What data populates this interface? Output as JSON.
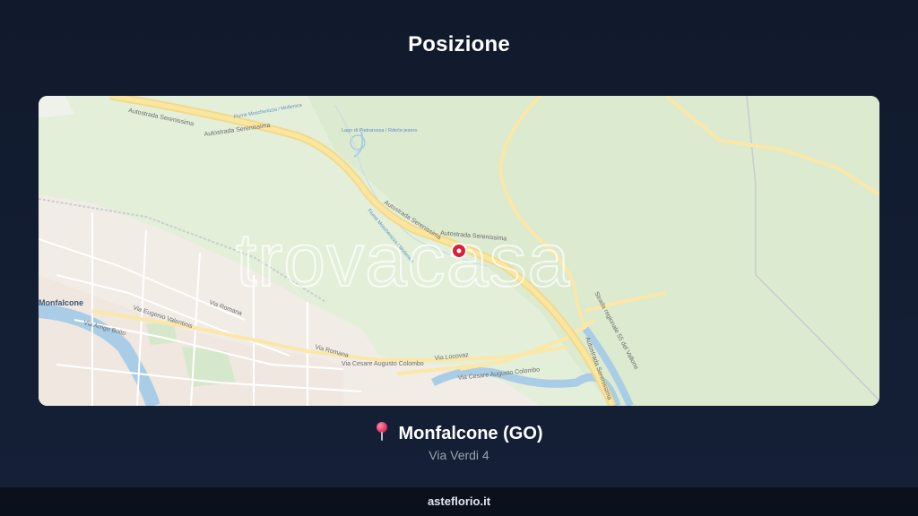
{
  "header": {
    "title": "Posizione"
  },
  "map": {
    "watermark_text": "trovacasa",
    "marker_color": "#d8203b",
    "labels": {
      "autostrada_1": "Autostrada Serenissima",
      "autostrada_2": "Autostrada Serenissima",
      "autostrada_3": "Autostrada Serenissima",
      "autostrada_4": "Autostrada Serenissima",
      "autostrada_5": "Autostrada Serenissima",
      "fiume_1": "Fiume Moschenizza / Mošenica",
      "fiume_2": "Fiume Moschenizza / Mošenica",
      "lago": "Lago di Pietrarossa / Rdeče jezero",
      "strada_regionale": "Strada regionale 55 del Vallone",
      "city": "Monfalcone",
      "via_valentinis": "Via Eugenio Valentinis",
      "via_boito": "Via Arrigo Boito",
      "via_romana_1": "Via Romana",
      "via_romana_2": "Via Romana",
      "via_colombo_1": "Via Cesare Augusto Colombo",
      "via_colombo_2": "Via Cesare Augusto Colombo",
      "via_locovaz": "Via Locovaz"
    }
  },
  "location": {
    "pin_icon": "round-pushpin",
    "city": "Monfalcone (GO)",
    "address": "Via Verdi 4"
  },
  "footer": {
    "site": "asteflorio.it"
  }
}
